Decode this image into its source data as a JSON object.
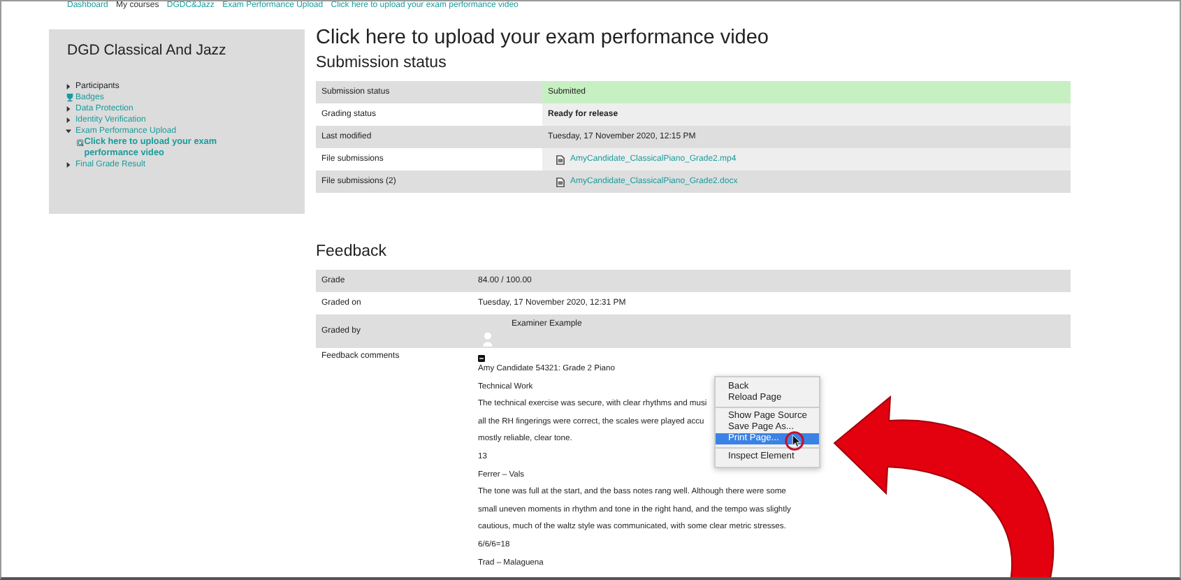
{
  "breadcrumb": [
    {
      "label": "Dashboard",
      "link": true
    },
    {
      "label": "My courses",
      "link": false
    },
    {
      "label": "DGDC&Jazz",
      "link": true
    },
    {
      "label": "Exam Performance Upload",
      "link": true
    },
    {
      "label": "Click here to upload your exam performance video",
      "link": true
    }
  ],
  "sidebar": {
    "title": "DGD Classical And Jazz",
    "items": [
      {
        "kind": "branch",
        "label": "Participants",
        "link": false,
        "expanded": false
      },
      {
        "kind": "badge",
        "label": "Badges",
        "link": true
      },
      {
        "kind": "branch",
        "label": "Data Protection",
        "link": true,
        "expanded": false
      },
      {
        "kind": "branch",
        "label": "Identity Verification",
        "link": true,
        "expanded": false
      },
      {
        "kind": "branch",
        "label": "Exam Performance Upload",
        "link": true,
        "expanded": true,
        "children": [
          {
            "kind": "activity",
            "label": "Click here to upload your exam performance video",
            "link": true
          }
        ]
      },
      {
        "kind": "branch",
        "label": "Final Grade Result",
        "link": true,
        "expanded": false
      }
    ]
  },
  "page_title": "Click here to upload your exam performance video",
  "submission": {
    "heading": "Submission status",
    "rows": [
      {
        "kind": "text",
        "label": "Submission status",
        "value": "Submitted",
        "highlighted": true,
        "bold": false
      },
      {
        "kind": "text",
        "label": "Grading status",
        "value": "Ready for release",
        "highlighted": false,
        "bold": true
      },
      {
        "kind": "text",
        "label": "Last modified",
        "value": "Tuesday, 17 November 2020, 12:15 PM",
        "highlighted": false,
        "bold": false
      },
      {
        "kind": "file",
        "label": "File submissions",
        "value": "AmyCandidate_ClassicalPiano_Grade2.mp4"
      },
      {
        "kind": "file",
        "label": "File submissions (2)",
        "value": "AmyCandidate_ClassicalPiano_Grade2.docx"
      }
    ]
  },
  "feedback": {
    "heading": "Feedback",
    "rows": [
      {
        "kind": "text",
        "label": "Grade",
        "value": "84.00 / 100.00"
      },
      {
        "kind": "text",
        "label": "Graded on",
        "value": "Tuesday, 17 November 2020, 12:31 PM"
      },
      {
        "kind": "user",
        "label": "Graded by",
        "value": "Examiner Example"
      },
      {
        "kind": "comments",
        "label": "Feedback comments",
        "expanded": true,
        "lines": [
          "Amy Candidate 54321: Grade 2 Piano",
          "Technical Work",
          "The technical exercise was secure, with clear rhythms and musi",
          "all the RH fingerings were correct, the scales were played accu",
          "mostly reliable, clear tone.",
          "13",
          "Ferrer – Vals",
          "The tone was full at the start, and the bass notes rang well. Although there were some",
          "small uneven moments in rhythm and tone in the right hand, and the tempo was slightly",
          "cautious, much of the waltz style was communicated, with some clear metric stresses.",
          "6/6/6=18",
          "Trad – Malaguena"
        ]
      }
    ]
  },
  "context_menu": {
    "groups": [
      [
        {
          "label": "Back",
          "selected": false
        },
        {
          "label": "Reload Page",
          "selected": false
        }
      ],
      [
        {
          "label": "Show Page Source",
          "selected": false
        },
        {
          "label": "Save Page As...",
          "selected": false
        },
        {
          "label": "Print Page...",
          "selected": true
        }
      ],
      [
        {
          "label": "Inspect Element",
          "selected": false
        }
      ]
    ]
  }
}
